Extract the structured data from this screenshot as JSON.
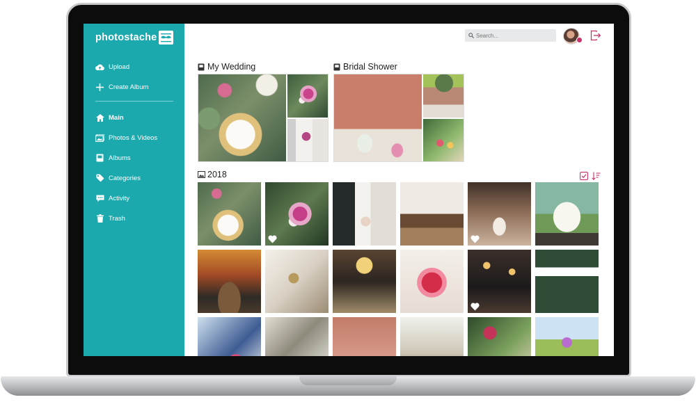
{
  "app": {
    "name": "photostache"
  },
  "sidebar": {
    "items": [
      {
        "label": "Upload",
        "icon": "cloud-upload-icon"
      },
      {
        "label": "Create Album",
        "icon": "plus-icon"
      },
      {
        "label": "Main",
        "icon": "home-icon",
        "active": true
      },
      {
        "label": "Photos & Videos",
        "icon": "image-icon"
      },
      {
        "label": "Albums",
        "icon": "album-icon"
      },
      {
        "label": "Categories",
        "icon": "tag-icon"
      },
      {
        "label": "Activity",
        "icon": "comment-icon"
      },
      {
        "label": "Trash",
        "icon": "trash-icon"
      }
    ]
  },
  "topbar": {
    "search_placeholder": "Search..."
  },
  "albums": [
    {
      "title": "My Wedding"
    },
    {
      "title": "Bridal Shower"
    }
  ],
  "section": {
    "title": "2018"
  },
  "colors": {
    "accent": "#1ba9ae",
    "logout": "#c7326a"
  }
}
